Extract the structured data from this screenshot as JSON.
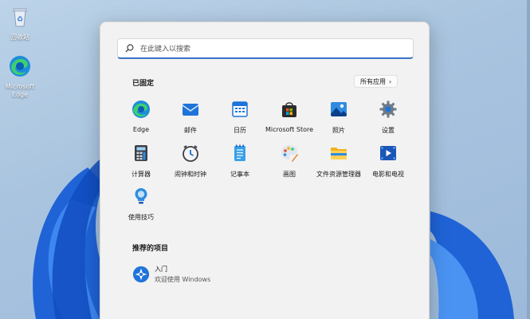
{
  "desktop": {
    "icons": [
      {
        "label": "回收站",
        "icon": "recycle-bin-icon"
      },
      {
        "label": "Microsoft Edge",
        "icon": "edge-icon"
      }
    ]
  },
  "start_menu": {
    "search": {
      "placeholder": "在此键入以搜索"
    },
    "pinned": {
      "title": "已固定",
      "all_apps_label": "所有应用",
      "apps": [
        {
          "label": "Edge",
          "icon": "edge-icon"
        },
        {
          "label": "邮件",
          "icon": "mail-icon"
        },
        {
          "label": "日历",
          "icon": "calendar-icon"
        },
        {
          "label": "Microsoft Store",
          "icon": "store-icon"
        },
        {
          "label": "照片",
          "icon": "photos-icon"
        },
        {
          "label": "设置",
          "icon": "settings-icon"
        },
        {
          "label": "计算器",
          "icon": "calculator-icon"
        },
        {
          "label": "闹钟和时钟",
          "icon": "alarm-clock-icon"
        },
        {
          "label": "记事本",
          "icon": "notepad-icon"
        },
        {
          "label": "画图",
          "icon": "paint-icon"
        },
        {
          "label": "文件资源管理器",
          "icon": "file-explorer-icon"
        },
        {
          "label": "电影和电视",
          "icon": "movies-tv-icon"
        },
        {
          "label": "使用技巧",
          "icon": "tips-icon"
        }
      ]
    },
    "recommended": {
      "title": "推荐的项目",
      "items": [
        {
          "title": "入门",
          "subtitle": "欢迎使用 Windows",
          "icon": "get-started-icon"
        }
      ]
    }
  }
}
